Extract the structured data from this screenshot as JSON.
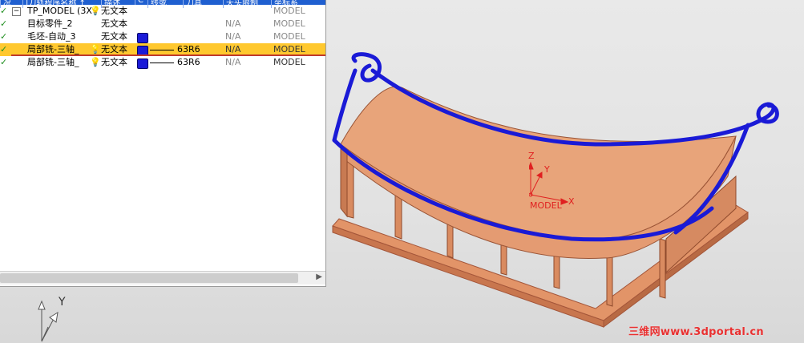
{
  "header": {
    "columns": [
      "况",
      "|刀轨程序名称 ↑",
      "描述",
      "C",
      "线或",
      "刀具",
      "天头限制",
      "坐标系"
    ]
  },
  "tree": {
    "rows": [
      {
        "name": "TP_MODEL (3X",
        "expander": "−",
        "text": "无文本",
        "coord": "MODEL"
      },
      {
        "name": "目标零件_2",
        "text": "无文本",
        "na": "N/A",
        "coord": "MODEL"
      },
      {
        "name": "毛坯-自动_3",
        "text": "无文本",
        "na": "N/A",
        "coord": "MODEL"
      },
      {
        "name": "局部铣-三轴_",
        "text": "无文本",
        "tool": "63R6",
        "na": "N/A",
        "coord": "MODEL",
        "selected": true
      },
      {
        "name": "局部铣-三轴_",
        "text": "无文本",
        "tool": "63R6",
        "na": "N/A",
        "coord": "MODEL"
      }
    ],
    "check_glyph": "✓"
  },
  "viewport": {
    "triad_label": "Y",
    "wcs": {
      "z": "Z",
      "y": "Y",
      "x": "X",
      "name": "MODEL"
    },
    "watermark": "三维网www.3dportal.cn"
  },
  "colors": {
    "selection": "#ffc82e",
    "toolpath": "#1a1ad6",
    "part": "#e8956a",
    "wcs": "#e02020",
    "header": "#1f5fd0"
  },
  "icons": [
    "check-icon",
    "bulb-icon",
    "collapse-icon",
    "color-swatch-icon",
    "scroll-right-icon"
  ]
}
